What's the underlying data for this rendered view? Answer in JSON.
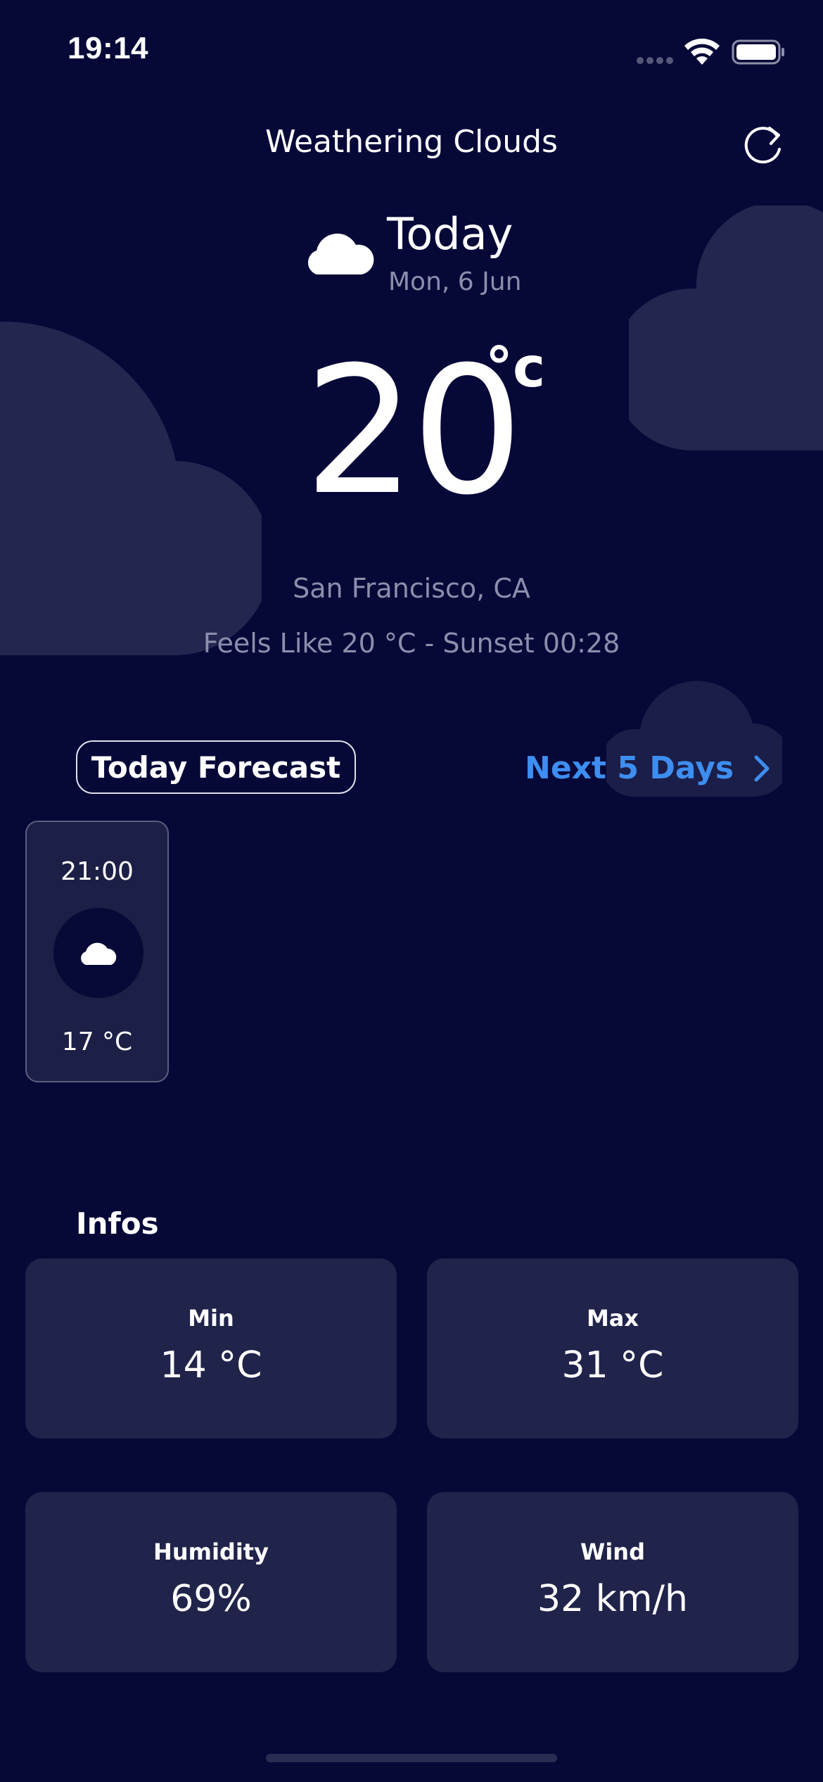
{
  "status_bar": {
    "time": "19:14",
    "icons": [
      "signal-dots-icon",
      "wifi-icon",
      "battery-icon"
    ]
  },
  "header": {
    "title": "Weathering Clouds",
    "refresh_icon": "refresh-icon"
  },
  "today": {
    "label": "Today",
    "date": "Mon, 6 Jun",
    "icon": "cloud-icon",
    "temperature": "20",
    "unit": "°c",
    "location": "San Francisco, CA",
    "feels_like": "Feels Like 20 °C - Sunset 00:28"
  },
  "forecast": {
    "tab_label": "Today Forecast",
    "next_days_label": "Next 5 Days",
    "hours": [
      {
        "time": "21:00",
        "icon": "cloud-icon",
        "temp": "17 °C"
      }
    ]
  },
  "infos": {
    "title": "Infos",
    "cards": [
      {
        "label": "Min",
        "value": "14 °C"
      },
      {
        "label": "Max",
        "value": "31 °C"
      },
      {
        "label": "Humidity",
        "value": "69%"
      },
      {
        "label": "Wind",
        "value": "32 km/h"
      }
    ]
  },
  "colors": {
    "background": "#060838",
    "card": "#20234a",
    "accent": "#3d8ef0",
    "muted_text": "#8c8fab",
    "bg_cloud": "#23264e"
  }
}
